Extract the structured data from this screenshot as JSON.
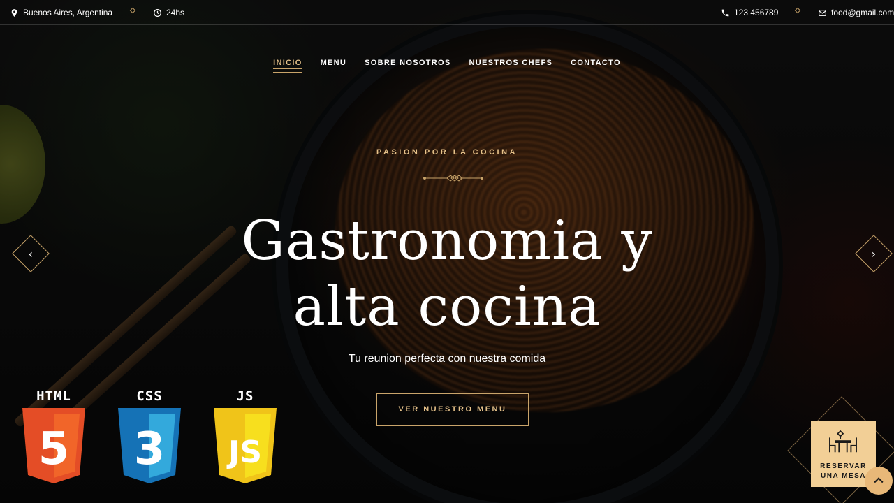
{
  "topbar": {
    "location": "Buenos Aires, Argentina",
    "hours": "24hs",
    "phone": "123 456789",
    "email": "food@gmail.com"
  },
  "nav": {
    "items": [
      {
        "label": "INICIO",
        "active": true
      },
      {
        "label": "MENU",
        "active": false
      },
      {
        "label": "SOBRE NOSOTROS",
        "active": false
      },
      {
        "label": "NUESTROS CHEFS",
        "active": false
      },
      {
        "label": "CONTACTO",
        "active": false
      }
    ]
  },
  "hero": {
    "eyebrow": "PASION POR LA COCINA",
    "title_line1": "Gastronomia y",
    "title_line2": "alta cocina",
    "subtitle": "Tu reunion perfecta con nuestra comida",
    "cta_label": "VER NUESTRO MENU"
  },
  "badges": [
    {
      "label": "HTML",
      "digit": "5",
      "color": "#e44d26",
      "shade": "#f16529",
      "icon": "html5-icon"
    },
    {
      "label": "CSS",
      "digit": "3",
      "color": "#1572b6",
      "shade": "#33a9dc",
      "icon": "css3-icon"
    },
    {
      "label": "JS",
      "digit": "JS",
      "color": "#f0c419",
      "shade": "#f7df1e",
      "icon": "js-icon"
    }
  ],
  "reserve": {
    "line1": "RESERVAR",
    "line2": "UNA MESA"
  },
  "colors": {
    "accent": "#c9a46a",
    "accent_light": "#e6c28a",
    "reserve_bg": "#f2cf96"
  }
}
